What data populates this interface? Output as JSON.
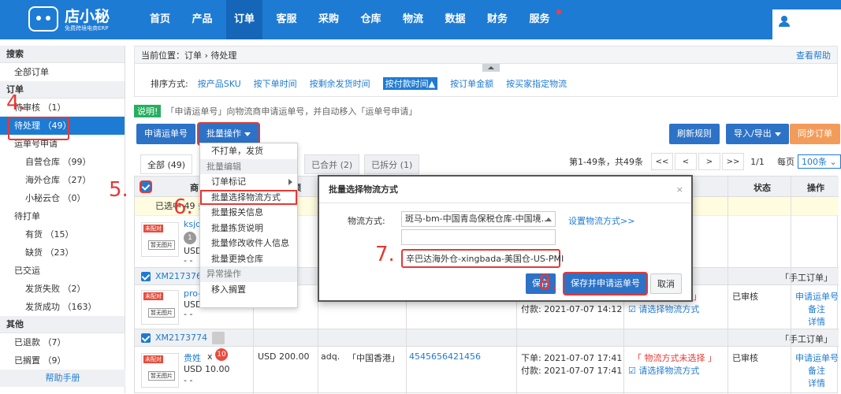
{
  "app": {
    "name": "店小秘",
    "tagline": "免费跨境电商ERP"
  },
  "nav": {
    "items": [
      "首页",
      "产品",
      "订单",
      "客服",
      "采购",
      "仓库",
      "物流",
      "数据",
      "财务",
      "服务"
    ],
    "active_index": 2
  },
  "sidebar": {
    "search_head": "搜索",
    "all_orders": "全部订单",
    "order_head": "订单",
    "pending_review": "待审核 （1）",
    "pending_process": "待处理 （49）",
    "waybill_apply": "运单号申请",
    "own_warehouse": "自营仓库 （99）",
    "overseas_warehouse": "海外仓库 （27）",
    "xiaomi_cloud": "小秘云仓 （0）",
    "to_print": "待打单",
    "in_stock": "有货 （15）",
    "out_stock": "缺货 （23）",
    "shipped": "已交运",
    "ship_fail": "发货失败 （2）",
    "ship_success": "发货成功 （163）",
    "other_head": "其他",
    "refunded": "已退款 （7）",
    "shelved": "已搁置 （9）",
    "help_manual": "帮助手册"
  },
  "breadcrumb": {
    "label": "当前位置：",
    "path": "订单 › 待处理",
    "help": "查看帮助"
  },
  "sort": {
    "label": "排序方式:",
    "options": [
      "按产品SKU",
      "按下单时间",
      "按剩余发货时间",
      "按付款时间▲",
      "按订单金额",
      "按买家指定物流"
    ],
    "active_index": 3
  },
  "notice": {
    "tag": "说明!",
    "text": "「申请运单号」向物流商申请运单号，并自动移入「运单号申请」"
  },
  "toolbar": {
    "apply_waybill": "申请运单号",
    "batch_ops": "批量操作",
    "refresh_rules": "刷新规则",
    "import_export": "导入/导出",
    "sync_orders": "同步订单"
  },
  "tabs": [
    "全部 (49)",
    "已合并 (2)",
    "已拆分 (1)"
  ],
  "pager": {
    "info": "第1-49条，共49条",
    "first": "<<",
    "prev": "<",
    "next": ">",
    "last": ">>",
    "page": "1/1",
    "per_page_label": "每页",
    "per_page": "100条"
  },
  "table": {
    "head_goods": "商",
    "head_amount": "额",
    "head_status": "状态",
    "head_ops": "操作",
    "selected_text": "已选中 49 条",
    "row1": {
      "title": "ksjd",
      "qty": "1",
      "currency": "USD",
      "dashes": "- -"
    },
    "row2": {
      "id": "XM2173766",
      "type": "「手工订单」",
      "title": "pro-",
      "currency": "USD",
      "dashes": "- -",
      "pay_time": "付款: 2021-07-07 14:12",
      "logistics_warn": "」",
      "logistics_link": "请选择物流方式",
      "status": "已审核",
      "op_apply": "申请运单号",
      "op_note": "备注",
      "op_detail": "详情"
    },
    "row3": {
      "id": "XM2173774",
      "type": "「手工订单」",
      "title": "贵姓",
      "mult": "x",
      "qty": "10",
      "currency": "USD 10.00",
      "dashes": "- -",
      "amount": "USD 200.00",
      "buyer": "adq.",
      "region": "「中国香港」",
      "tracking": "4545656421456",
      "order_time": "下单: 2021-07-07 17:41",
      "pay_time": "付款: 2021-07-07 17:41",
      "logistics_warn": "「 物流方式未选择 」",
      "logistics_link": "请选择物流方式",
      "status": "已审核",
      "op_apply": "申请运单号",
      "op_note": "备注",
      "op_detail": "详情"
    },
    "thumb_tag": "未配对",
    "thumb_label": "暂无图片"
  },
  "dropdown": {
    "no_print_ship": "不打单，发货",
    "group_batch_edit": "批量编辑",
    "order_mark": "订单标记",
    "batch_select_logistics": "批量选择物流方式",
    "batch_customs": "批量报关信息",
    "batch_split": "批量拣货说明",
    "batch_receiver": "批量修改收件人信息",
    "batch_warehouse": "批量更换仓库",
    "group_exception": "异常操作",
    "move_shelved": "移入搁置"
  },
  "modal": {
    "title": "批量选择物流方式",
    "close": "×",
    "label": "物流方式:",
    "selected": "斑马-bm-中国青岛保税仓库-中国境...",
    "set_link": "设置物流方式>>",
    "option": "辛巴达海外仓-xingbada-美国仓-US-PMI",
    "save": "保存",
    "save_apply": "保存并申请运单号",
    "cancel": "取消"
  },
  "steps": [
    "4.",
    "5.",
    "6.",
    "7.",
    "8."
  ]
}
